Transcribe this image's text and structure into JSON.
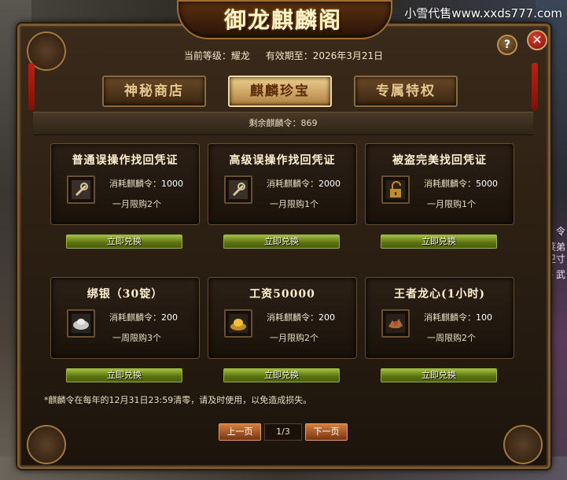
{
  "watermark": "小雪代售www.xxds777.com",
  "window": {
    "title": "御龙麒麟阁"
  },
  "header": {
    "level_label": "当前等级：耀龙",
    "expiry_label": "有效期至：2026年3月21日"
  },
  "tabs": [
    {
      "label": "神秘商店",
      "active": false
    },
    {
      "label": "麒麟珍宝",
      "active": true
    },
    {
      "label": "专属特权",
      "active": false
    }
  ],
  "balance": "剩余麒麟令：869",
  "items": [
    {
      "title": "普通误操作找回凭证",
      "cost_label": "消耗麒麟令：",
      "cost": "1000",
      "limit": "一月限购2个",
      "button": "立即兑换",
      "icon": "repair-tool-icon"
    },
    {
      "title": "高级误操作找回凭证",
      "cost_label": "消耗麒麟令：",
      "cost": "2000",
      "limit": "一月限购1个",
      "button": "立即兑换",
      "icon": "repair-tool-icon"
    },
    {
      "title": "被盗完美找回凭证",
      "cost_label": "消耗麒麟令：",
      "cost": "5000",
      "limit": "一月限购1个",
      "button": "立即兑换",
      "icon": "unlocked-padlock-icon"
    },
    {
      "title": "绑银（30锭）",
      "cost_label": "消耗麒麟令：",
      "cost": "200",
      "limit": "一周限购3个",
      "button": "立即兑换",
      "icon": "silver-ingot-icon"
    },
    {
      "title": "工资50000",
      "cost_label": "消耗麒麟令：",
      "cost": "200",
      "limit": "一月限购2个",
      "button": "立即兑换",
      "icon": "gold-ingot-icon"
    },
    {
      "title": "王者龙心(1小时)",
      "cost_label": "消耗麒麟令：",
      "cost": "100",
      "limit": "一周限购2个",
      "button": "立即兑换",
      "icon": "dragon-heart-icon"
    }
  ],
  "notice": "*麒麟令在每年的12月31日23:59清零，请及时使用，以免造成损失。",
  "pagination": {
    "prev": "上一页",
    "current": "1/3",
    "next": "下一页"
  },
  "side_text": [
    "令",
    "莱弟",
    "卫寸",
    "- 武"
  ],
  "colors": {
    "accent_gold": "#c09050",
    "cost_value": "#ffffff",
    "button_green": "#6a8a18"
  }
}
